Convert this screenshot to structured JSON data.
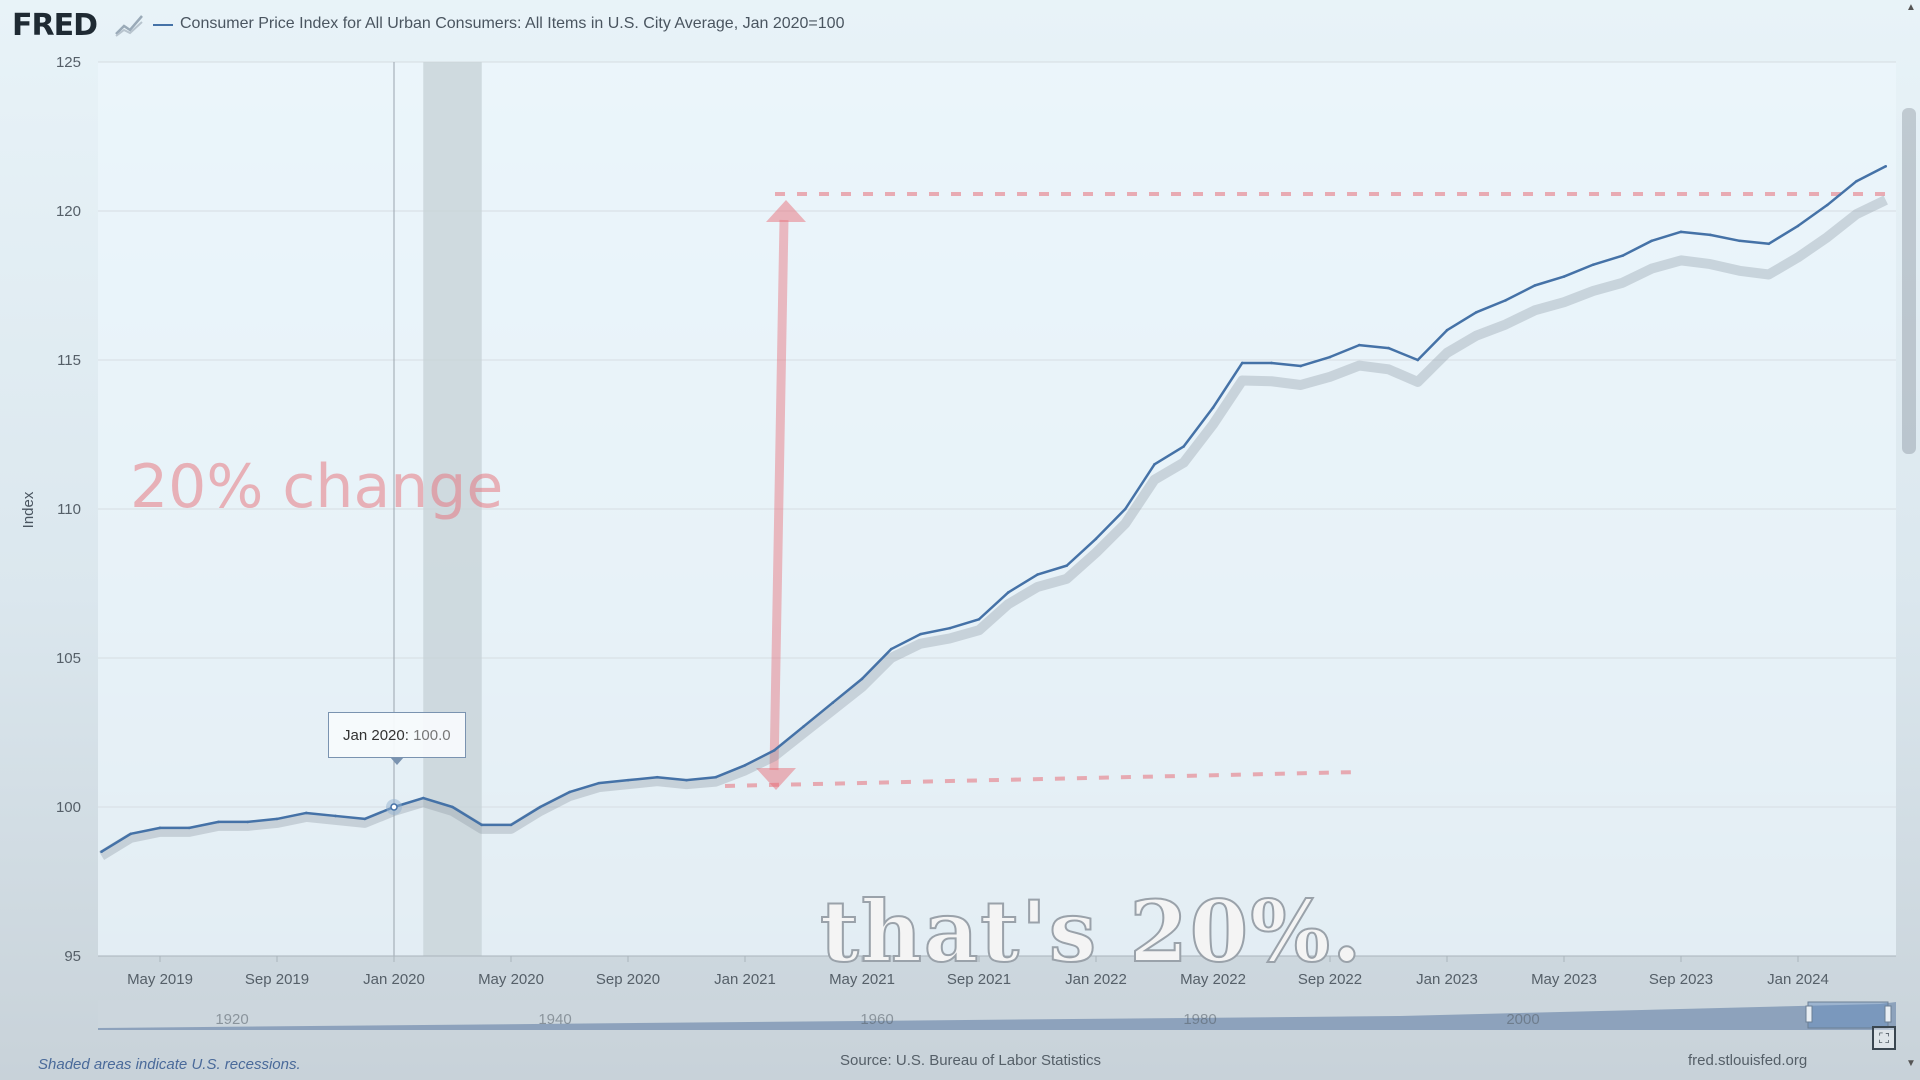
{
  "header": {
    "logo": "FRED",
    "legend_label": "Consumer Price Index for All Urban Consumers: All Items in U.S. City Average, Jan 2020=100"
  },
  "tooltip": {
    "date": "Jan 2020:",
    "value": "100.0"
  },
  "overlay": {
    "headline": "20% change",
    "caption": "that's 20%."
  },
  "footer": {
    "recession_note": "Shaded areas indicate U.S. recessions.",
    "source": "Source: U.S. Bureau of Labor Statistics",
    "site": "fred.stlouisfed.org"
  },
  "colors": {
    "series": "#4572a7",
    "recession": "#c8d3d8",
    "annotation": "#e8707a"
  },
  "chart_data": {
    "type": "line",
    "title": "Consumer Price Index for All Urban Consumers: All Items in U.S. City Average, Jan 2020=100",
    "ylabel": "Index",
    "xlabel": "",
    "ylim": [
      95,
      125
    ],
    "yticks": [
      95,
      100,
      105,
      110,
      115,
      120,
      125
    ],
    "xticks": [
      "May 2019",
      "Sep 2019",
      "Jan 2020",
      "May 2020",
      "Sep 2020",
      "Jan 2021",
      "May 2021",
      "Sep 2021",
      "Jan 2022",
      "May 2022",
      "Sep 2022",
      "Jan 2023",
      "May 2023",
      "Sep 2023",
      "Jan 2024"
    ],
    "x": [
      "Mar 2019",
      "Apr 2019",
      "May 2019",
      "Jun 2019",
      "Jul 2019",
      "Aug 2019",
      "Sep 2019",
      "Oct 2019",
      "Nov 2019",
      "Dec 2019",
      "Jan 2020",
      "Feb 2020",
      "Mar 2020",
      "Apr 2020",
      "May 2020",
      "Jun 2020",
      "Jul 2020",
      "Aug 2020",
      "Sep 2020",
      "Oct 2020",
      "Nov 2020",
      "Dec 2020",
      "Jan 2021",
      "Feb 2021",
      "Mar 2021",
      "Apr 2021",
      "May 2021",
      "Jun 2021",
      "Jul 2021",
      "Aug 2021",
      "Sep 2021",
      "Oct 2021",
      "Nov 2021",
      "Dec 2021",
      "Jan 2022",
      "Feb 2022",
      "Mar 2022",
      "Apr 2022",
      "May 2022",
      "Jun 2022",
      "Jul 2022",
      "Aug 2022",
      "Sep 2022",
      "Oct 2022",
      "Nov 2022",
      "Dec 2022",
      "Jan 2023",
      "Feb 2023",
      "Mar 2023",
      "Apr 2023",
      "May 2023",
      "Jun 2023",
      "Jul 2023",
      "Aug 2023",
      "Sep 2023",
      "Oct 2023",
      "Nov 2023",
      "Dec 2023",
      "Jan 2024",
      "Feb 2024",
      "Mar 2024",
      "Apr 2024"
    ],
    "series": [
      {
        "values": [
          98.5,
          99.1,
          99.3,
          99.3,
          99.5,
          99.5,
          99.6,
          99.8,
          99.7,
          99.6,
          100.0,
          100.3,
          100.0,
          99.4,
          99.4,
          100.0,
          100.5,
          100.8,
          100.9,
          101.0,
          100.9,
          101.0,
          101.4,
          101.9,
          102.7,
          103.5,
          104.3,
          105.3,
          105.8,
          106.0,
          106.3,
          107.2,
          107.8,
          108.1,
          109.0,
          110.0,
          111.5,
          112.1,
          113.4,
          114.9,
          114.9,
          114.8,
          115.1,
          115.5,
          115.4,
          115.0,
          116.0,
          116.6,
          117.0,
          117.5,
          117.8,
          118.2,
          118.5,
          119.0,
          119.3,
          119.2,
          119.0,
          118.9,
          119.5,
          120.2,
          121.0,
          121.5
        ]
      }
    ],
    "recessions": [
      [
        "Feb 2020",
        "Apr 2020"
      ]
    ],
    "time_axis_labels": [
      "1920",
      "1940",
      "1960",
      "1980",
      "2000"
    ],
    "grid": true,
    "legend": "top-left"
  }
}
